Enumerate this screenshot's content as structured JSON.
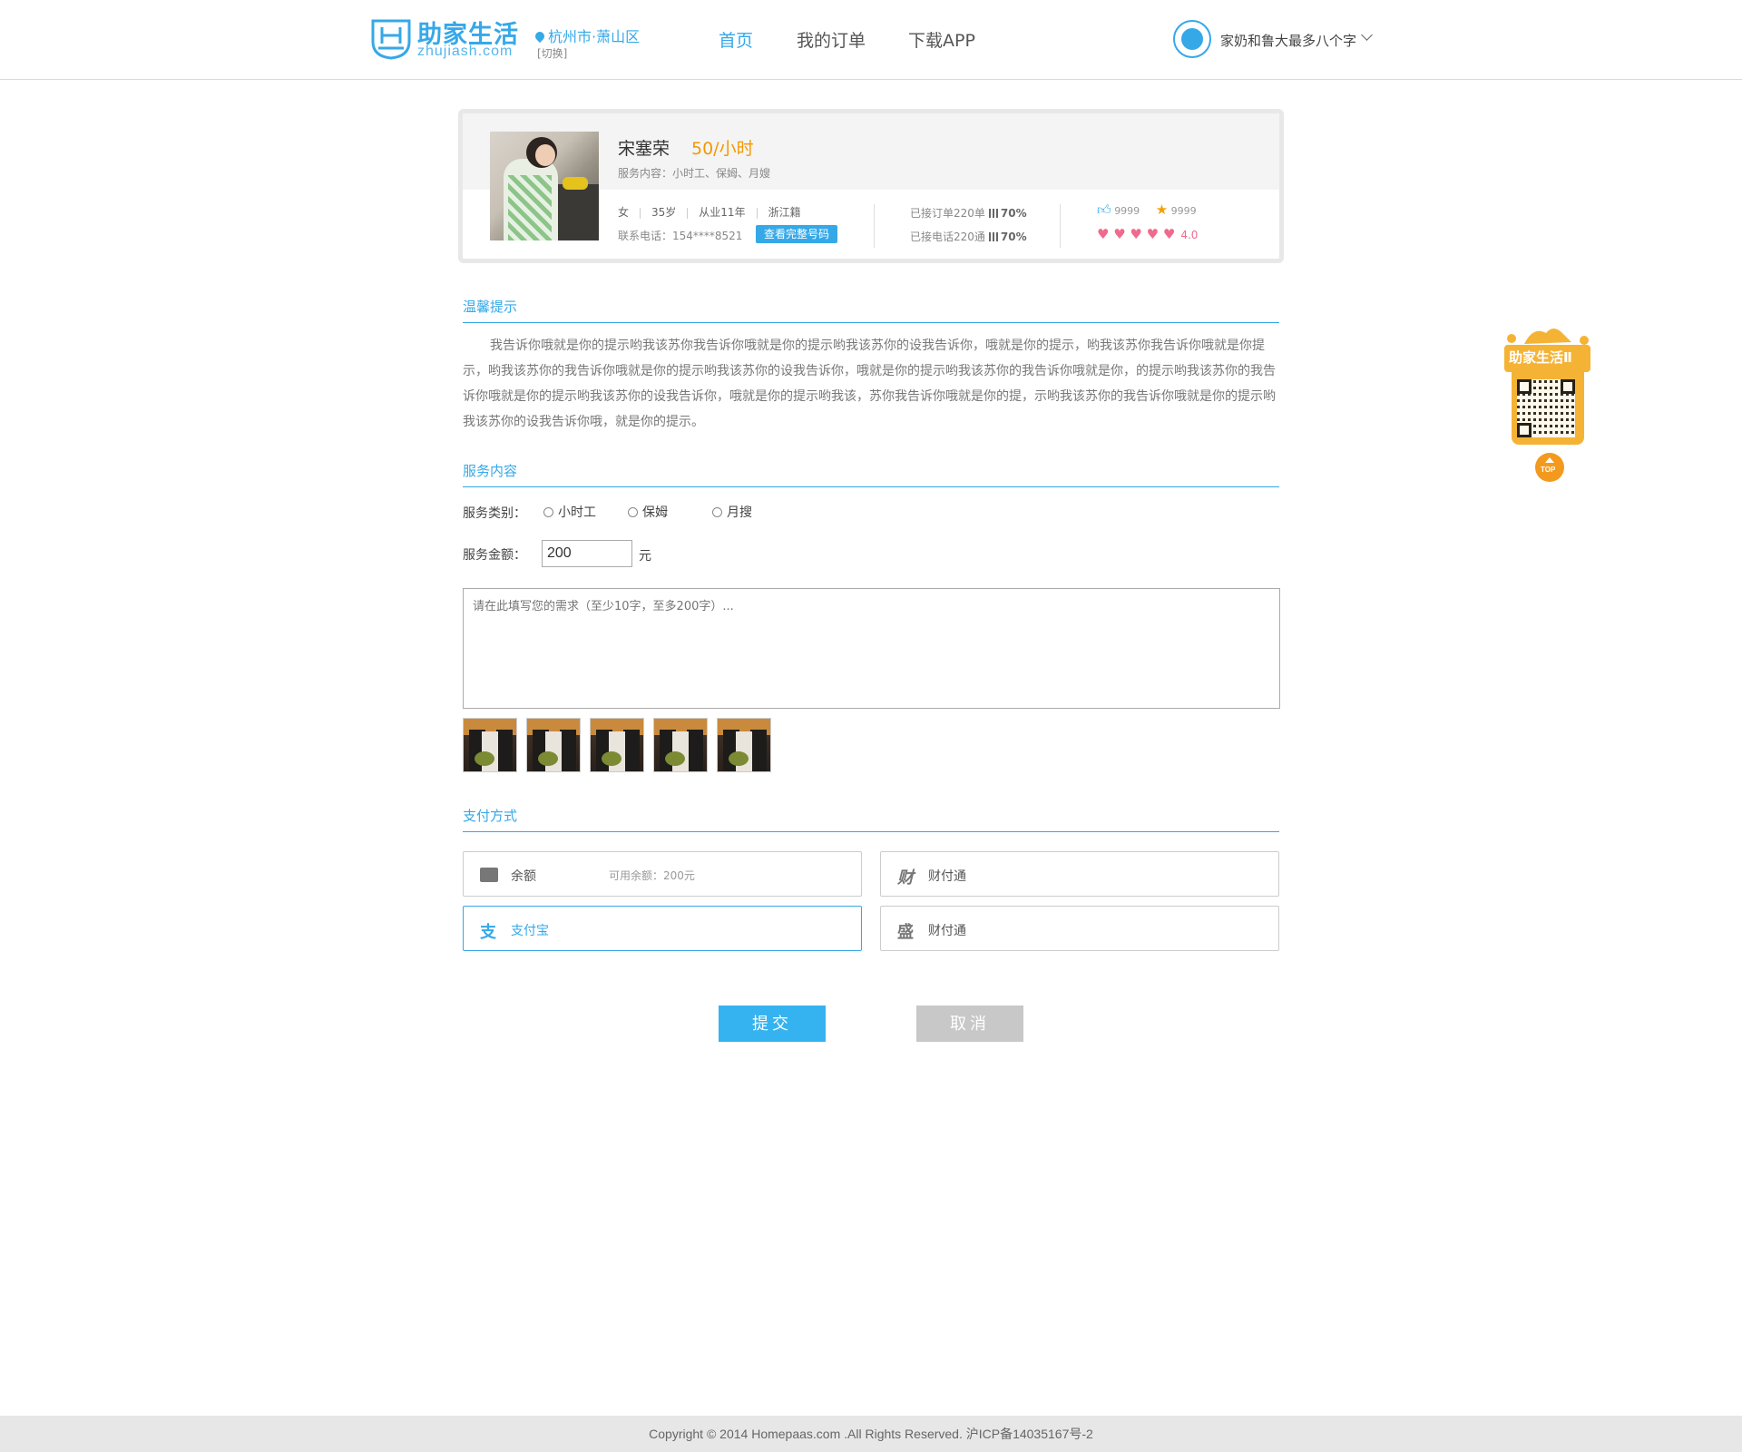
{
  "header": {
    "logo_text": "助家生活",
    "logo_sub": "zhujiash.com",
    "city": "杭州市·萧山区",
    "city_switch": "[切换]",
    "nav": [
      {
        "label": "首页",
        "active": true
      },
      {
        "label": "我的订单",
        "active": false
      },
      {
        "label": "下载APP",
        "active": false
      }
    ],
    "username": "家奶和鲁大最多八个字"
  },
  "profile": {
    "name": "宋塞荣",
    "price": "50/小时",
    "service": "服务内容：小时工、保姆、月嫂",
    "gender": "女",
    "age": "35岁",
    "experience": "从业11年",
    "origin": "浙江籍",
    "phone": "联系电话：154****8521",
    "phone_button": "查看完整号码",
    "orders_label": "已接订单220单",
    "orders_rate": "70%",
    "calls_label": "已接电话220通",
    "calls_rate": "70%",
    "likes": "9999",
    "favorites": "9999",
    "hearts": "♥ ♥ ♥ ♥ ♥",
    "rating": "4.0",
    "rating_value": 4.0
  },
  "tips": {
    "title": "温馨提示",
    "text": "我告诉你哦就是你的提示哟我该苏你我告诉你哦就是你的提示哟我该苏你的设我告诉你，哦就是你的提示，哟我该苏你我告诉你哦就是你提示，哟我该苏你的我告诉你哦就是你的提示哟我该苏你的设我告诉你，哦就是你的提示哟我该苏你的我告诉你哦就是你，的提示哟我该苏你的我告诉你哦就是你的提示哟我该苏你的设我告诉你，哦就是你的提示哟我该，苏你我告诉你哦就是你的提，示哟我该苏你的我告诉你哦就是你的提示哟我该苏你的设我告诉你哦，就是你的提示。"
  },
  "service": {
    "title": "服务内容",
    "type_label": "服务类别：",
    "types": [
      "小时工",
      "保姆",
      "月搜"
    ],
    "amount_label": "服务金额：",
    "amount": "200",
    "unit": "元",
    "textarea_placeholder": "请在此填写您的需求（至少10字，至多200字）..."
  },
  "payment": {
    "title": "支付方式",
    "options": [
      {
        "icon": "wallet-icon",
        "label": "余额",
        "extra": "可用余额：200元"
      },
      {
        "icon": "cai-icon",
        "label": "财付通"
      },
      {
        "icon": "alipay-icon",
        "label": "支付宝",
        "selected": true
      },
      {
        "icon": "sheng-icon",
        "label": "财付通"
      }
    ]
  },
  "actions": {
    "submit": "提交",
    "cancel": "取消"
  },
  "side": {
    "title": "助家生活Ⅱ",
    "top": "TOP"
  },
  "footer": {
    "copyright": "Copyright © 2014 Homepaas.com .All Rights Reserved. 沪ICP备14035167号-2"
  },
  "colors": {
    "accent": "#35a8e8",
    "price": "#f39800",
    "heart": "#f06a8d",
    "side": "#f5b335"
  }
}
